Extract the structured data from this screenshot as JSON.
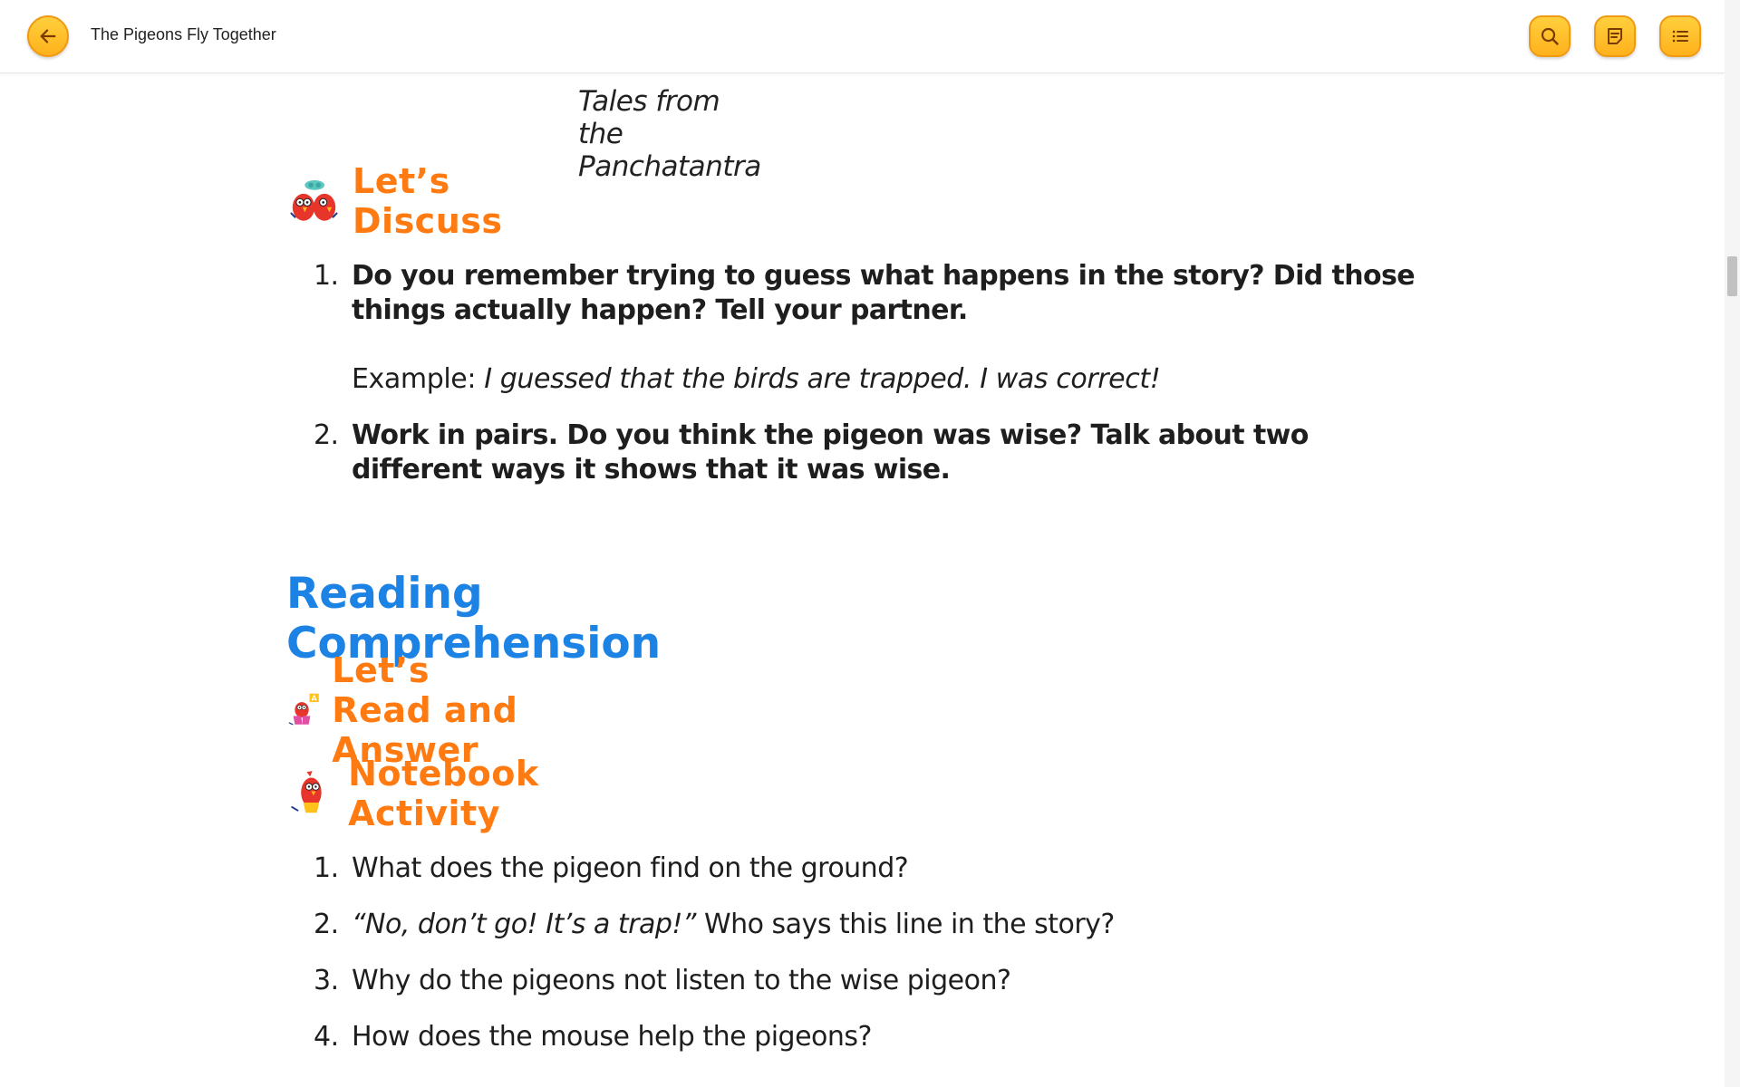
{
  "header": {
    "title": "The Pigeons Fly Together",
    "back_icon": "arrow-left-icon",
    "search_icon": "search-icon",
    "notes_icon": "notes-icon",
    "toc_icon": "list-icon"
  },
  "colors": {
    "accent": "#ffb21c",
    "section_heading": "#ff7a10",
    "big_heading": "#1c82e3"
  },
  "content": {
    "source": "Tales from the Panchatantra",
    "discuss": {
      "heading": "Let’s Discuss",
      "items": [
        {
          "num": "1.",
          "text": "Do you remember trying to guess what happens in the story? Did those things actually happen? Tell your partner.",
          "example_label": "Example: ",
          "example_text": "I guessed that the birds are trapped. I was correct!"
        },
        {
          "num": "2.",
          "text": "Work in pairs. Do you think the pigeon was wise? Talk about two different ways it shows that it was wise."
        }
      ]
    },
    "reading_comprehension": "Reading Comprehension",
    "read_answer": {
      "heading": "Let’s Read and Answer"
    },
    "notebook": {
      "heading": "Notebook Activity",
      "items": [
        {
          "num": "1.",
          "text": "What does the pigeon find on the ground?"
        },
        {
          "num": "2.",
          "italic": "“No, don’t go! It’s a trap!”",
          "text": " Who says this line in the story?"
        },
        {
          "num": "3.",
          "text": "Why do the pigeons not listen to the wise pigeon?"
        },
        {
          "num": "4.",
          "text": "How does the mouse help the pigeons?"
        }
      ]
    }
  }
}
